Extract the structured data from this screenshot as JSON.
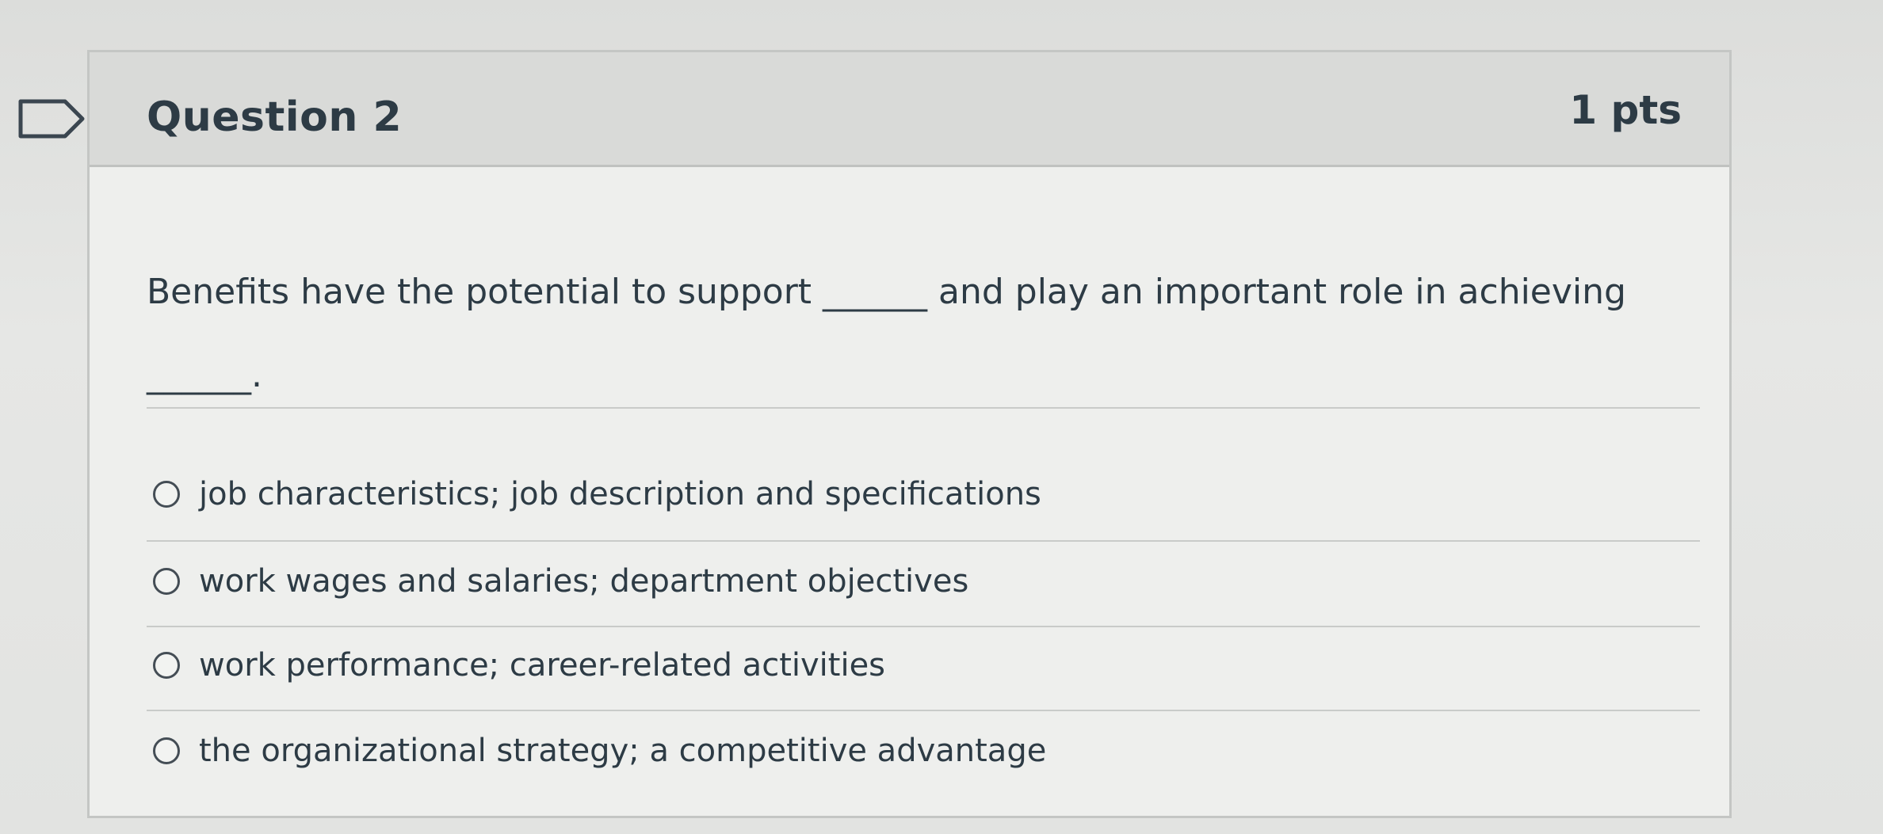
{
  "question": {
    "title": "Question 2",
    "points": "1 pts",
    "text_line1": "Benefits have the potential to support ______ and play an important role in achieving",
    "text_line2": "______."
  },
  "answers": [
    {
      "label": "job characteristics; job description and specifications",
      "selected": false
    },
    {
      "label": "work wages and salaries; department objectives",
      "selected": false
    },
    {
      "label": "work performance; career-related activities",
      "selected": false
    },
    {
      "label": "the organizational strategy; a competitive advantage",
      "selected": false
    }
  ],
  "icons": {
    "flag": "flag-question-icon",
    "radio": "radio-button-icon"
  },
  "colors": {
    "text": "#2d3b45",
    "header_bg": "#d9dad8",
    "card_bg": "#eeefed",
    "border": "#c4c6c4"
  }
}
